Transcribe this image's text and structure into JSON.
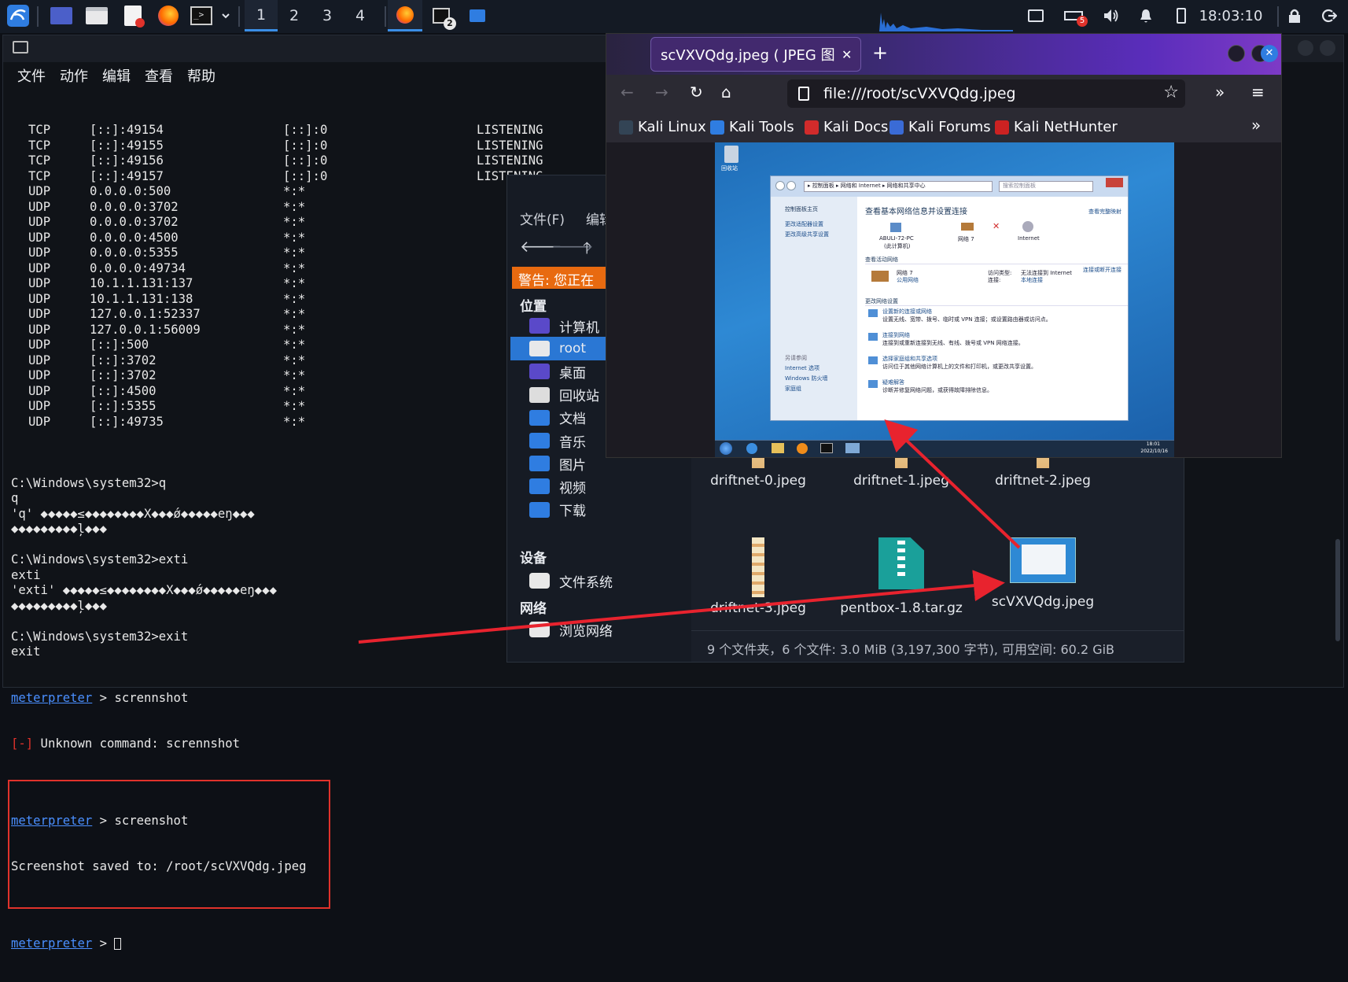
{
  "panel": {
    "workspaces": [
      "1",
      "2",
      "3",
      "4"
    ],
    "task_badge": "2",
    "notif_badge": "5",
    "clock": "18:03:10"
  },
  "terminal": {
    "menu": [
      "文件",
      "动作",
      "编辑",
      "查看",
      "帮助"
    ],
    "rows": [
      {
        "proto": "TCP",
        "local": "[::]:49154",
        "remote": "[::]:0",
        "state": "LISTENING"
      },
      {
        "proto": "TCP",
        "local": "[::]:49155",
        "remote": "[::]:0",
        "state": "LISTENING"
      },
      {
        "proto": "TCP",
        "local": "[::]:49156",
        "remote": "[::]:0",
        "state": "LISTENING"
      },
      {
        "proto": "TCP",
        "local": "[::]:49157",
        "remote": "[::]:0",
        "state": "LISTENING"
      },
      {
        "proto": "UDP",
        "local": "0.0.0.0:500",
        "remote": "*:*",
        "state": ""
      },
      {
        "proto": "UDP",
        "local": "0.0.0.0:3702",
        "remote": "*:*",
        "state": ""
      },
      {
        "proto": "UDP",
        "local": "0.0.0.0:3702",
        "remote": "*:*",
        "state": ""
      },
      {
        "proto": "UDP",
        "local": "0.0.0.0:4500",
        "remote": "*:*",
        "state": ""
      },
      {
        "proto": "UDP",
        "local": "0.0.0.0:5355",
        "remote": "*:*",
        "state": ""
      },
      {
        "proto": "UDP",
        "local": "0.0.0.0:49734",
        "remote": "*:*",
        "state": ""
      },
      {
        "proto": "UDP",
        "local": "10.1.1.131:137",
        "remote": "*:*",
        "state": ""
      },
      {
        "proto": "UDP",
        "local": "10.1.1.131:138",
        "remote": "*:*",
        "state": ""
      },
      {
        "proto": "UDP",
        "local": "127.0.0.1:52337",
        "remote": "*:*",
        "state": ""
      },
      {
        "proto": "UDP",
        "local": "127.0.0.1:56009",
        "remote": "*:*",
        "state": ""
      },
      {
        "proto": "UDP",
        "local": "[::]:500",
        "remote": "*:*",
        "state": ""
      },
      {
        "proto": "UDP",
        "local": "[::]:3702",
        "remote": "*:*",
        "state": ""
      },
      {
        "proto": "UDP",
        "local": "[::]:3702",
        "remote": "*:*",
        "state": ""
      },
      {
        "proto": "UDP",
        "local": "[::]:4500",
        "remote": "*:*",
        "state": ""
      },
      {
        "proto": "UDP",
        "local": "[::]:5355",
        "remote": "*:*",
        "state": ""
      },
      {
        "proto": "UDP",
        "local": "[::]:49735",
        "remote": "*:*",
        "state": ""
      }
    ],
    "lines": [
      "",
      "C:\\Windows\\system32>q",
      "q",
      "'q' ◆◆◆◆◆≤◆◆◆◆◆◆◆◆X◆◆◆ǿ◆◆◆◆◆eŋ◆◆◆",
      "◆◆◆◆◆◆◆◆◆ļ◆◆◆",
      "",
      "C:\\Windows\\system32>exti",
      "exti",
      "'exti' ◆◆◆◆◆≤◆◆◆◆◆◆◆◆X◆◆◆ǿ◆◆◆◆◆eŋ◆◆◆",
      "◆◆◆◆◆◆◆◆◆ļ◆◆◆",
      "",
      "C:\\Windows\\system32>exit",
      "exit"
    ],
    "prompt": "meterpreter",
    "cmd1": " > scrennshot",
    "err_tag": "[-]",
    "err_text": " Unknown command: scrennshot",
    "cmd2": " > screenshot",
    "saved": "Screenshot saved to: /root/scVXVQdg.jpeg",
    "cmd3": " > "
  },
  "filemanager": {
    "menu_file": "文件(F)",
    "menu_edit": "编辑",
    "warning": "警告: 您正在",
    "sec_places": "位置",
    "places": [
      "计算机",
      "root",
      "桌面",
      "回收站",
      "文档",
      "音乐",
      "图片",
      "视频",
      "下载"
    ],
    "sec_devices": "设备",
    "devices": [
      "文件系统"
    ],
    "sec_network": "网络",
    "network": [
      "浏览网络"
    ],
    "files": [
      "driftnet-0.jpeg",
      "driftnet-1.jpeg",
      "driftnet-2.jpeg",
      "driftnet-3.jpeg",
      "pentbox-1.8.tar.gz",
      "scVXVQdg.jpeg"
    ],
    "status": "9 个文件夹，6 个文件: 3.0 MiB (3,197,300 字节), 可用空间: 60.2 GiB"
  },
  "firefox": {
    "tab_title": "scVXVQdg.jpeg ( JPEG 图像",
    "url": "file:///root/scVXVQdg.jpeg",
    "bookmarks": [
      "Kali Linux",
      "Kali Tools",
      "Kali Docs",
      "Kali Forums",
      "Kali NetHunter"
    ]
  },
  "win7": {
    "recycle": "回收站",
    "breadcrumb": "▸ 控制面板 ▸ 网络和 Internet ▸ 网络和共享中心",
    "search": "搜索控制面板",
    "side_title": "控制面板主页",
    "side_links": [
      "更改适配器设置",
      "更改高级共享设置"
    ],
    "see_also": "另请参阅",
    "see_links": [
      "Internet 选项",
      "Windows 防火墙",
      "家庭组"
    ],
    "heading": "查看基本网络信息并设置连接",
    "full_map": "查看完整映射",
    "pc_label": "ABULI-72-PC",
    "pc_sub": "(此计算机)",
    "net_label": "网络 7",
    "inet_label": "Internet",
    "active_title": "查看活动网络",
    "connect_link": "连接或断开连接",
    "net7": "网络 7",
    "public_net": "公用网络",
    "access_type": "访问类型:",
    "access_val": "无法连接到 Internet",
    "conn": "连接:",
    "conn_val": "本地连接",
    "change_title": "更改网络设置",
    "tasks": [
      {
        "t": "设置新的连接或网络",
        "d": "设置无线、宽带、拨号、临时或 VPN 连接；或设置路由器或访问点。"
      },
      {
        "t": "连接到网络",
        "d": "连接到或重新连接到无线、有线、拨号或 VPN 网络连接。"
      },
      {
        "t": "选择家庭组和共享选项",
        "d": "访问位于其他网络计算机上的文件和打印机，或更改共享设置。"
      },
      {
        "t": "疑难解答",
        "d": "诊断并修复网络问题，或获得故障排除信息。"
      }
    ],
    "tray_time": "18:01",
    "tray_date": "2022/10/16"
  }
}
